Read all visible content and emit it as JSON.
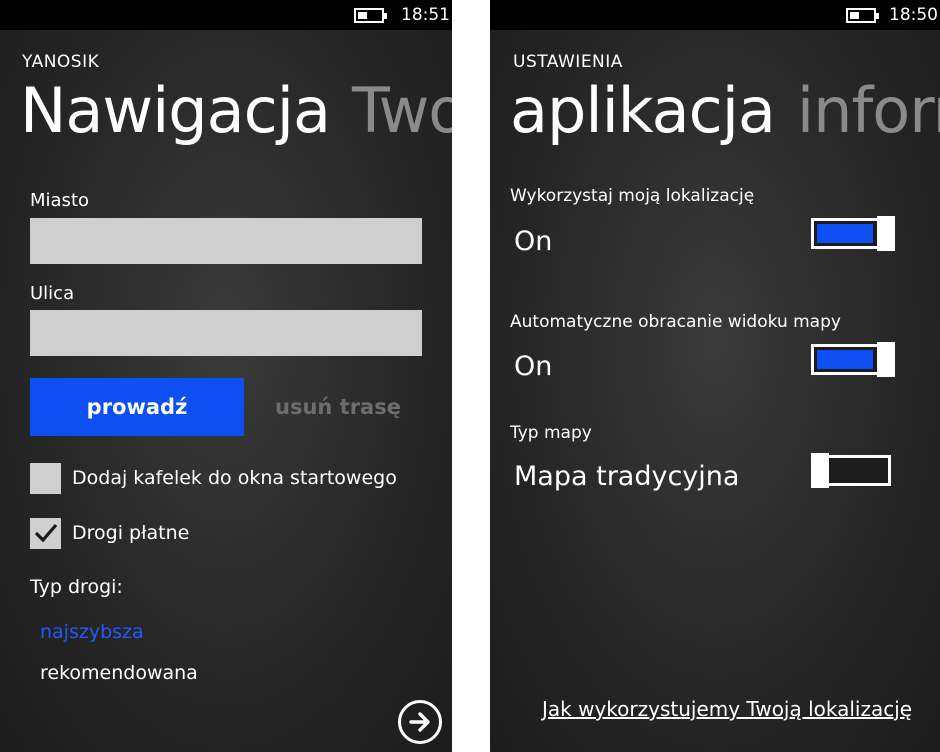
{
  "left": {
    "status": {
      "time": "18:51"
    },
    "app_title": "YANOSIK",
    "pivot": {
      "active": "Nawigacja",
      "next": "Twoj"
    },
    "city": {
      "label": "Miasto",
      "value": ""
    },
    "street": {
      "label": "Ulica",
      "value": ""
    },
    "navigate_label": "prowadź",
    "clear_route_label": "usuń trasę",
    "add_tile": {
      "label": "Dodaj kafelek do okna startowego",
      "checked": false
    },
    "toll_roads": {
      "label": "Drogi płatne",
      "checked": true
    },
    "road_type": {
      "label": "Typ drogi:",
      "options": [
        "najszybsza",
        "rekomendowana"
      ],
      "selected": "najszybsza"
    },
    "next_icon": "arrow-right-circle-icon"
  },
  "right": {
    "status": {
      "time": "18:50"
    },
    "app_title": "USTAWIENIA",
    "pivot": {
      "active": "aplikacja",
      "next": "inform"
    },
    "settings": [
      {
        "label": "Wykorzystaj moją lokalizację",
        "value": "On",
        "on": true
      },
      {
        "label": "Automatyczne obracanie widoku mapy",
        "value": "On",
        "on": true
      },
      {
        "label": "Typ mapy",
        "value": "Mapa tradycyjna",
        "on": false
      }
    ],
    "privacy_link": "Jak wykorzystujemy Twoją lokalizację"
  },
  "colors": {
    "accent": "#0d4ff2",
    "accent_text": "#1e5bff",
    "textbox": "#cfcfcf",
    "disabled_text": "#6d6d6d",
    "inactive_pivot": "#8a8a8a"
  }
}
